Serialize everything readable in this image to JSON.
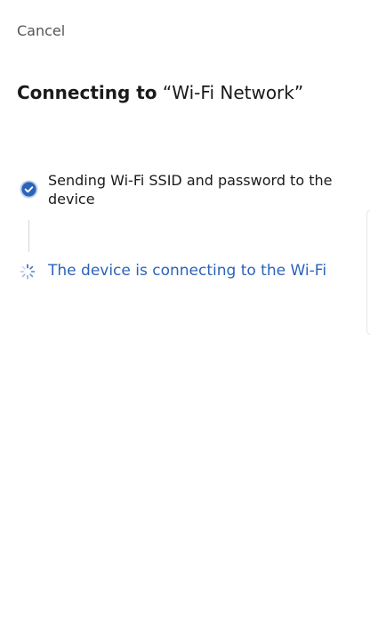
{
  "header": {
    "cancel_label": "Cancel"
  },
  "title": {
    "prefix": "Connecting to",
    "network": "“Wi-Fi Network”"
  },
  "steps": [
    {
      "label": "Sending Wi-Fi SSID and password to the device",
      "status": "done",
      "icon": "check-circle-icon"
    },
    {
      "label": "The device is connecting to the Wi-Fi",
      "status": "in-progress",
      "icon": "spinner-icon"
    }
  ],
  "colors": {
    "accent": "#2c63b8",
    "text": "#1a1a1a",
    "muted": "#555555"
  }
}
